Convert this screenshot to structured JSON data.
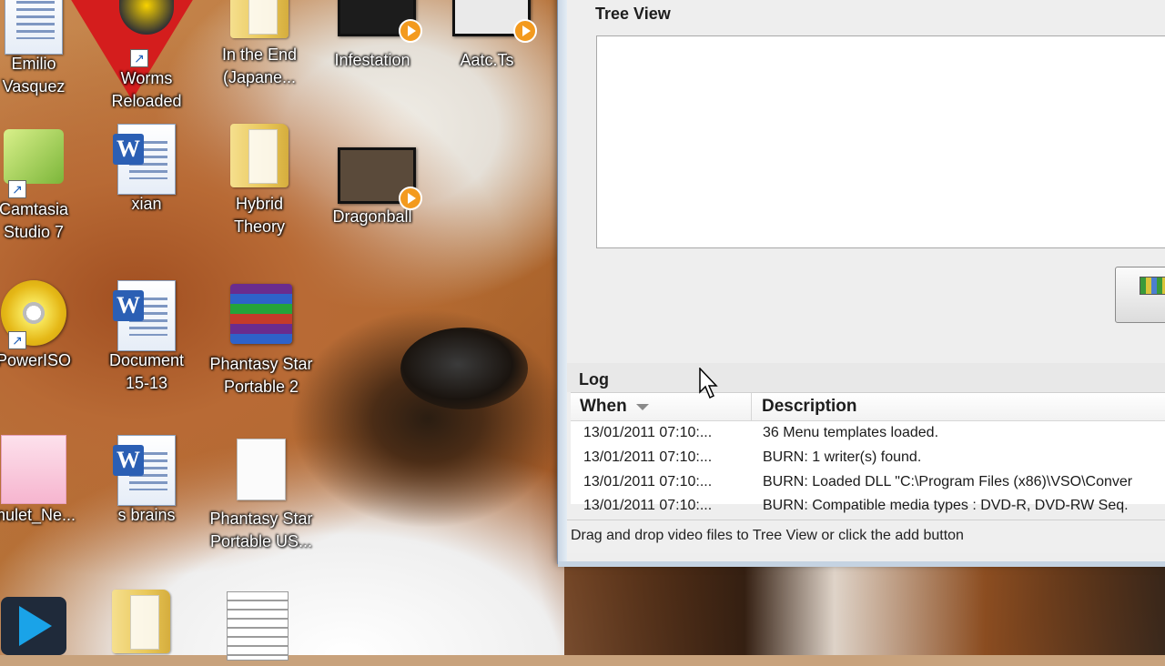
{
  "desktop": {
    "icons": [
      {
        "label": "Emilio\nVasquez"
      },
      {
        "label": "Worms\nReloaded"
      },
      {
        "label": "In the End\n(Japane..."
      },
      {
        "label": "Infestation"
      },
      {
        "label": "Aatc.Ts"
      },
      {
        "label": "Camtasia\nStudio 7"
      },
      {
        "label": "xian"
      },
      {
        "label": "Hybrid\nTheory"
      },
      {
        "label": "Dragonball"
      },
      {
        "label": "PowerISO"
      },
      {
        "label": "Document\n15-13"
      },
      {
        "label": "Phantasy Star\nPortable 2"
      },
      {
        "label": "mulet_Ne..."
      },
      {
        "label": "s brains"
      },
      {
        "label": "Phantasy Star\nPortable US..."
      }
    ]
  },
  "window": {
    "tree_view_title": "Tree View",
    "log_title": "Log",
    "log": {
      "columns": [
        "When",
        "Description"
      ],
      "rows": [
        {
          "when": "13/01/2011 07:10:...",
          "description": "36 Menu templates loaded."
        },
        {
          "when": "13/01/2011 07:10:...",
          "description": "BURN: 1 writer(s) found."
        },
        {
          "when": "13/01/2011 07:10:...",
          "description": "BURN: Loaded DLL \"C:\\Program Files (x86)\\VSO\\Conver"
        },
        {
          "when": "13/01/2011 07:10:...",
          "description": "BURN:  Compatible media types : DVD-R, DVD-RW Seq."
        }
      ]
    },
    "status_text": "Drag and drop video files to Tree View or click the add button"
  }
}
